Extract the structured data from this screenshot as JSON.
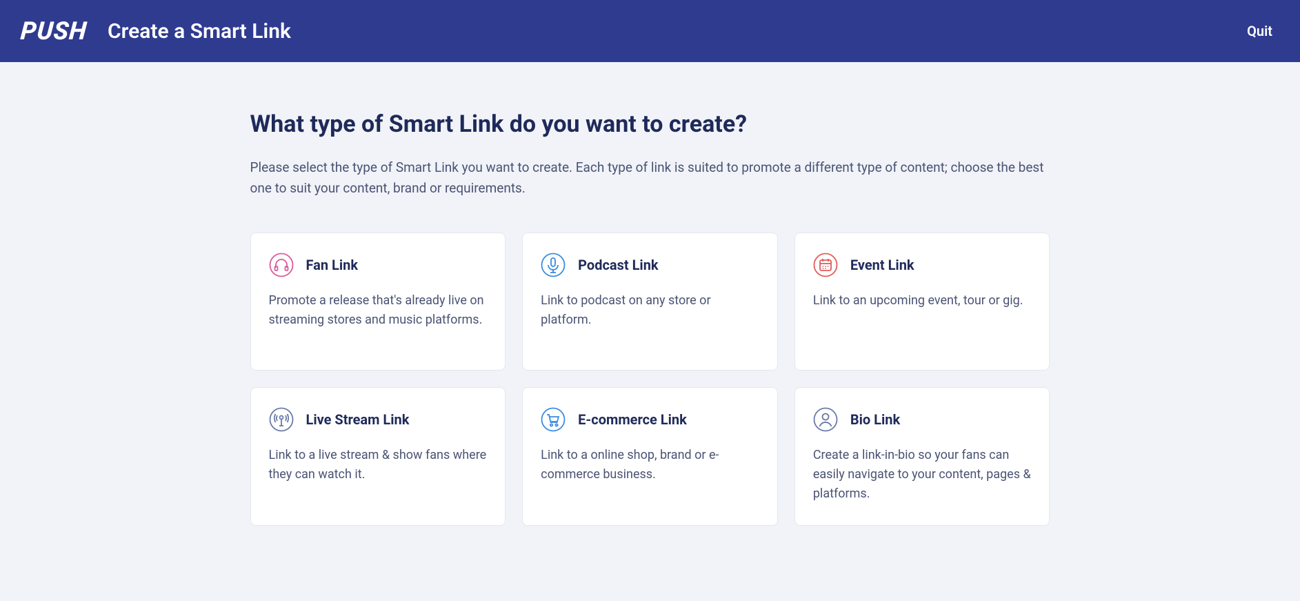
{
  "header": {
    "logo_text": "PUSH",
    "title": "Create a Smart Link",
    "quit_label": "Quit"
  },
  "main": {
    "heading": "What type of Smart Link do you want to create?",
    "description": "Please select the type of Smart Link you want to create. Each type of link is suited to promote a different type of content; choose the best one to suit your content, brand or requirements."
  },
  "cards": [
    {
      "icon": "headphones-icon",
      "icon_color": "#d95b9a",
      "title": "Fan Link",
      "description": "Promote a release that's already live on streaming stores and music platforms."
    },
    {
      "icon": "microphone-icon",
      "icon_color": "#3a8be0",
      "title": "Podcast Link",
      "description": "Link to podcast on any store or platform."
    },
    {
      "icon": "calendar-icon",
      "icon_color": "#e25b5b",
      "title": "Event Link",
      "description": "Link to an upcoming event, tour or gig."
    },
    {
      "icon": "broadcast-icon",
      "icon_color": "#6a7aa8",
      "title": "Live Stream Link",
      "description": "Link to a live stream & show fans where they can watch it."
    },
    {
      "icon": "cart-icon",
      "icon_color": "#3a8be0",
      "title": "E-commerce Link",
      "description": "Link to a online shop, brand or e-commerce business."
    },
    {
      "icon": "user-icon",
      "icon_color": "#6a7aa8",
      "title": "Bio Link",
      "description": "Create a link-in-bio so your fans can easily navigate to your content, pages & platforms."
    }
  ]
}
